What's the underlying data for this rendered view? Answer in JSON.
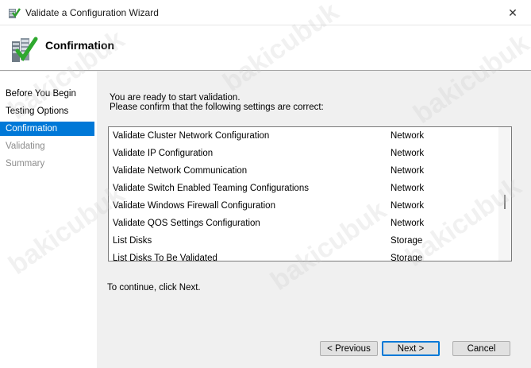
{
  "window": {
    "title": "Validate a Configuration Wizard",
    "close_glyph": "✕"
  },
  "header": {
    "title": "Confirmation"
  },
  "sidebar": {
    "steps": [
      {
        "label": "Before You Begin",
        "state": "done"
      },
      {
        "label": "Testing Options",
        "state": "done"
      },
      {
        "label": "Confirmation",
        "state": "active"
      },
      {
        "label": "Validating",
        "state": "pending"
      },
      {
        "label": "Summary",
        "state": "pending"
      }
    ]
  },
  "main": {
    "intro_line1": "You are ready to start validation.",
    "intro_line2": "Please confirm that the following settings are correct:",
    "tests": [
      {
        "name": "Validate Cluster Network Configuration",
        "category": "Network"
      },
      {
        "name": "Validate IP Configuration",
        "category": "Network"
      },
      {
        "name": "Validate Network Communication",
        "category": "Network"
      },
      {
        "name": "Validate Switch Enabled Teaming Configurations",
        "category": "Network"
      },
      {
        "name": "Validate Windows Firewall Configuration",
        "category": "Network"
      },
      {
        "name": "Validate QOS Settings Configuration",
        "category": "Network"
      },
      {
        "name": "List Disks",
        "category": "Storage"
      },
      {
        "name": "List Disks To Be Validated",
        "category": "Storage"
      }
    ],
    "continue_text": "To continue, click Next."
  },
  "buttons": {
    "previous": "< Previous",
    "next": "Next >",
    "cancel": "Cancel"
  },
  "watermark": {
    "text": "bakicubuk"
  },
  "colors": {
    "accent": "#0078d7",
    "pending_text": "#8c8c8c"
  }
}
